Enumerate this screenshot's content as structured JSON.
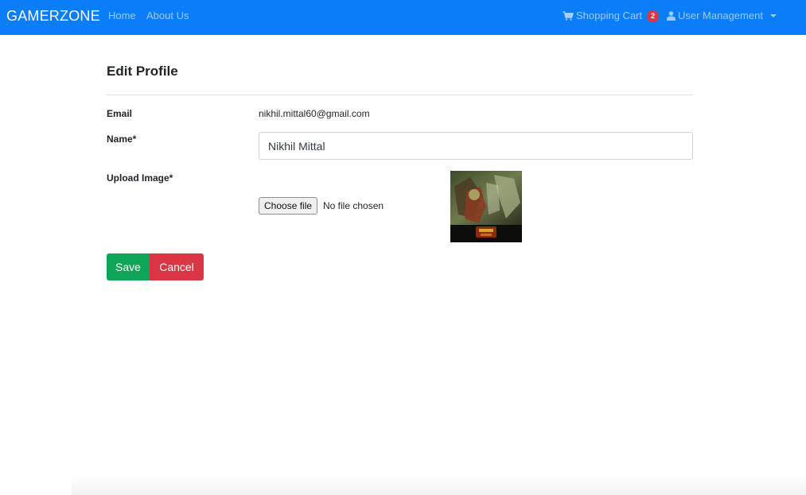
{
  "navbar": {
    "brand": "GAMERZONE",
    "links": [
      {
        "label": "Home"
      },
      {
        "label": "About Us"
      }
    ],
    "cart": {
      "label": "Shopping Cart",
      "count": "2",
      "icon": "shopping-cart-icon"
    },
    "user_menu": {
      "label": "User Management",
      "icon": "user-icon"
    },
    "accent_color": "#0a7df8"
  },
  "form": {
    "title": "Edit Profile",
    "email": {
      "label": "Email",
      "value": "nikhil.mittal60@gmail.com"
    },
    "name": {
      "label": "Name*",
      "value": "Nikhil Mittal"
    },
    "image": {
      "label": "Upload Image*",
      "button": "Choose file",
      "status": "No file chosen"
    }
  },
  "actions": {
    "save": "Save",
    "cancel": "Cancel",
    "save_color": "#0ea556",
    "cancel_color": "#dc3545"
  }
}
